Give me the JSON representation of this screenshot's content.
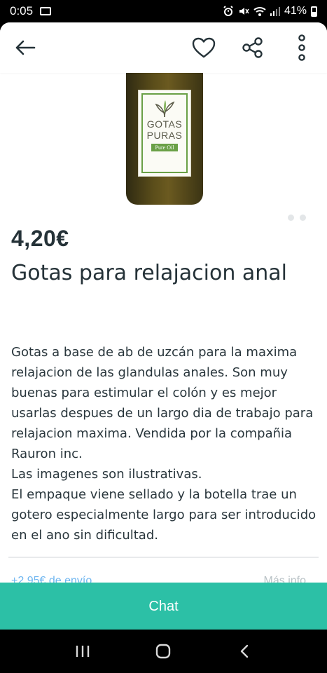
{
  "status_bar": {
    "time": "0:05",
    "battery": "41%",
    "icons": [
      "image-icon",
      "alarm-icon",
      "mute-icon",
      "wifi-icon",
      "signal-icon",
      "battery-icon"
    ]
  },
  "top_bar": {
    "icons": [
      "back-arrow-icon",
      "heart-icon",
      "share-icon",
      "more-vert-icon"
    ]
  },
  "product": {
    "image_label": {
      "line1": "GOTAS",
      "line2": "PURAS",
      "sub": "Pure Oil"
    },
    "carousel": {
      "total": 2,
      "current": 1
    },
    "price": "4,20€",
    "title": "Gotas para relajacion anal",
    "description": "Gotas a base de ab de uzcán para la maxima relajacion de las glandulas anales. Son muy buenas para estimular el colón y es mejor usarlas despues de un largo dia de trabajo para relajacion maxima. Vendida por la compañia Rauron inc.\nLas imagenes son ilustrativas.\nEl empaque viene sellado y la botella trae un gotero especialmente largo para ser introducido en el ano sin dificultad.",
    "shipping": "+2,95€ de envío",
    "more_info": "Más info"
  },
  "chat_button": {
    "label": "Chat"
  },
  "colors": {
    "accent": "#2cc0a6",
    "text": "#253238",
    "link": "#6fb6f0"
  }
}
